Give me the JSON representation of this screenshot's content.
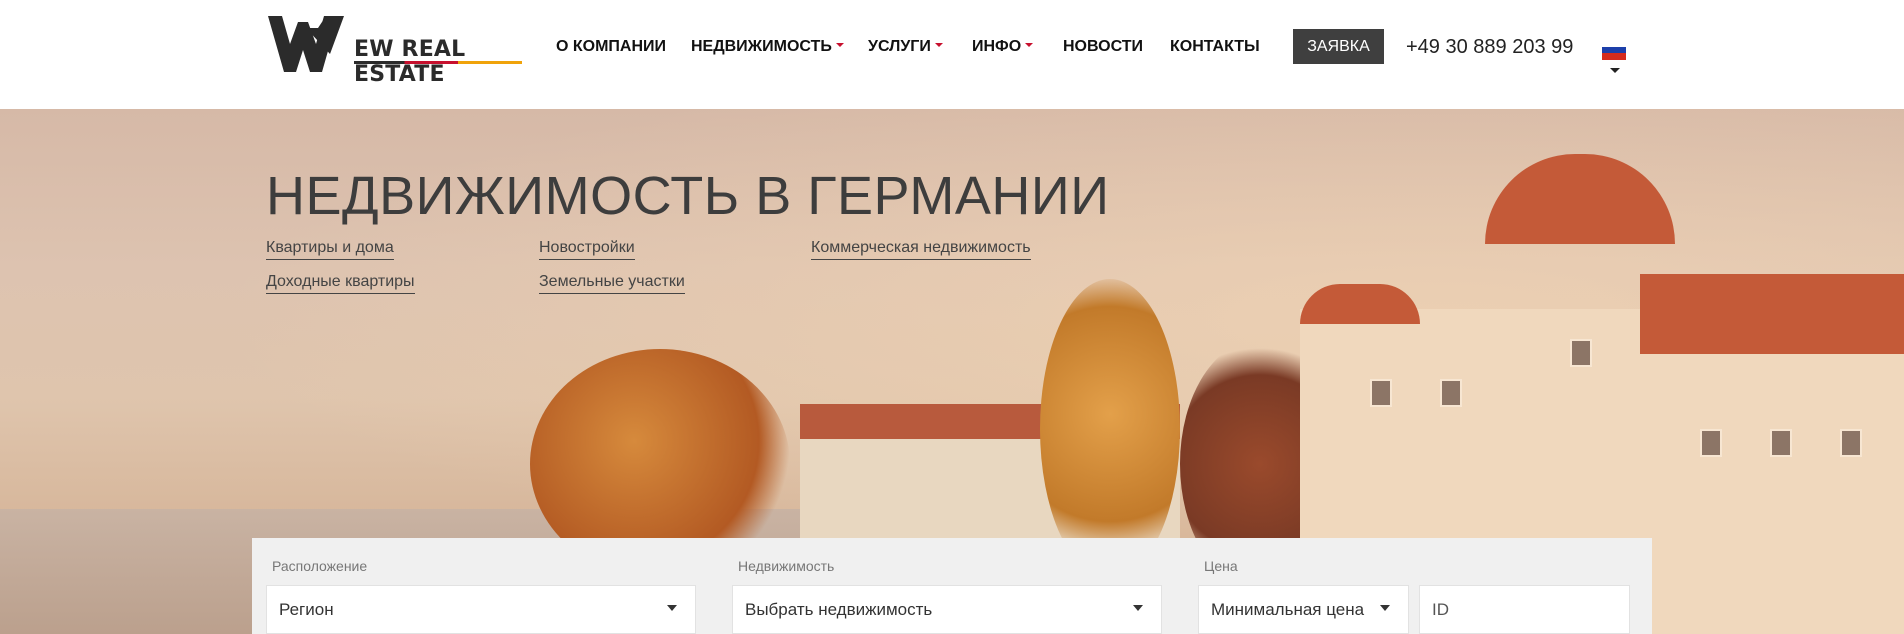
{
  "header": {
    "logo_text": "EW REAL ESTATE",
    "nav": [
      {
        "label": "О КОМПАНИИ",
        "has_caret": false
      },
      {
        "label": "НЕДВИЖИМОСТЬ",
        "has_caret": true
      },
      {
        "label": "УСЛУГИ",
        "has_caret": true
      },
      {
        "label": "ИНФО",
        "has_caret": true
      },
      {
        "label": "НОВОСТИ",
        "has_caret": false
      },
      {
        "label": "КОНТАКТЫ",
        "has_caret": false
      }
    ],
    "apply_label": "ЗАЯВКА",
    "phone": "+49 30 889 203 99",
    "language_flag": "flag-ru-icon",
    "accent_color": "#c7102e"
  },
  "hero": {
    "title": "НЕДВИЖИМОСТЬ В ГЕРМАНИИ",
    "links": [
      "Квартиры и дома",
      "Новостройки",
      "Коммерческая недвижимость",
      "Доходные квартиры",
      "Земельные участки"
    ]
  },
  "search": {
    "location_label": "Расположение",
    "location_value": "Регион",
    "property_label": "Недвижимость",
    "property_value": "Выбрать недвижимость",
    "price_label": "Цена",
    "price_value": "Минимальная цена",
    "id_placeholder": "ID"
  }
}
